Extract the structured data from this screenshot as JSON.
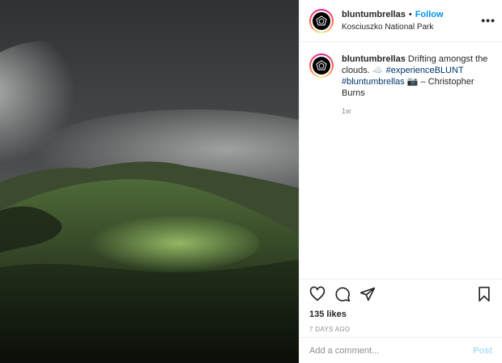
{
  "post": {
    "image_alt": "Misty green hills under dark clouds",
    "header": {
      "username": "bluntumbrellas",
      "separator": "•",
      "follow_label": "Follow",
      "location": "Kosciuszko National Park",
      "more_label": "•••"
    },
    "caption": {
      "username": "bluntumbrellas",
      "text_before": "Drifting amongst the clouds. ☁️ ",
      "hashtag1": "#experienceBLUNT",
      "hashtag2": "#bluntumbrellas",
      "text_after": " 📷 – Christopher Burns",
      "time_ago": "1w"
    },
    "actions": {
      "like_icon": "heart-icon",
      "comment_icon": "comment-icon",
      "share_icon": "paper-plane-icon",
      "save_icon": "bookmark-icon"
    },
    "likes": "135 likes",
    "date": "7 DAYS AGO",
    "comment": {
      "placeholder": "Add a comment...",
      "post_label": "Post"
    },
    "colors": {
      "link": "#0095f6",
      "hashtag": "#00376b",
      "muted": "#8e8e8e",
      "post_disabled": "#b2dffc"
    }
  }
}
